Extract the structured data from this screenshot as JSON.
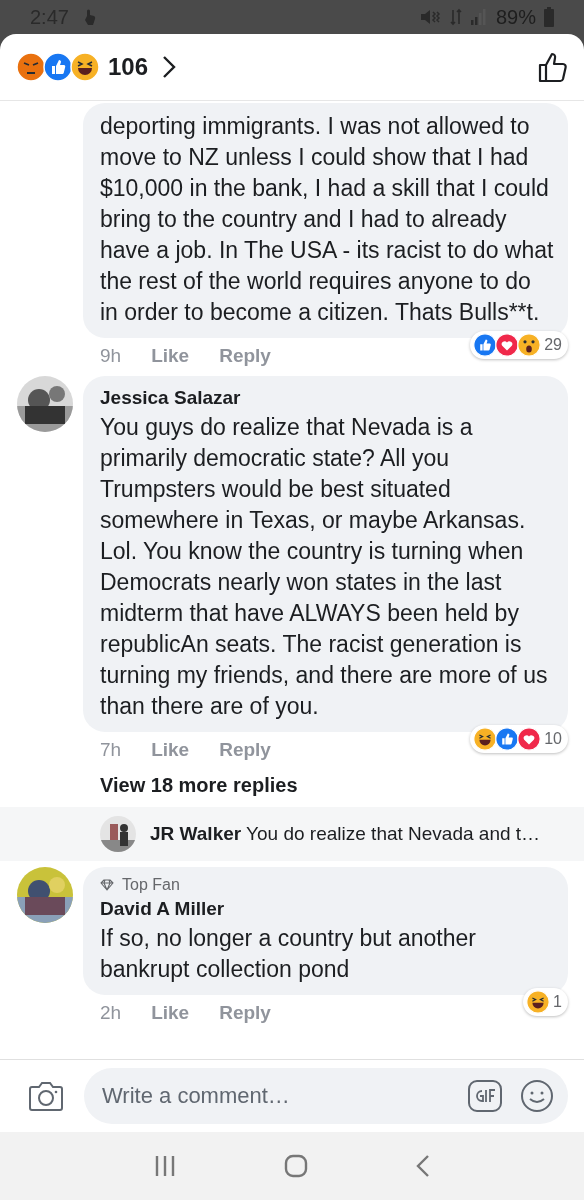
{
  "status_bar": {
    "time": "2:47",
    "battery": "89%"
  },
  "header": {
    "reactions": [
      {
        "kind": "angry"
      },
      {
        "kind": "like"
      },
      {
        "kind": "haha"
      }
    ],
    "count": "106"
  },
  "comments": [
    {
      "text": "deporting immigrants. I was not allowed to move to NZ unless I could show that I had $10,000 in the bank, I had a skill that I could bring to the country and I had to already have a job.   In The USA - its racist to do what the rest of the world requires anyone to do in order to become a citizen. Thats Bulls**t.",
      "time": "9h",
      "like": "Like",
      "reply": "Reply",
      "reactions": [
        {
          "kind": "like"
        },
        {
          "kind": "love"
        },
        {
          "kind": "wow"
        }
      ],
      "reaction_count": "29"
    },
    {
      "author": "Jessica Salazar",
      "text": "You guys do realize that Nevada is a primarily democratic state? All you Trumpsters would be best situated somewhere in Texas, or maybe Arkansas. Lol. You know the country is turning when Democrats nearly won states in the last midterm that have ALWAYS been held by republicAn seats. The racist generation is turning my friends, and there are more of us than there are of you.",
      "time": "7h",
      "like": "Like",
      "reply": "Reply",
      "reactions": [
        {
          "kind": "haha"
        },
        {
          "kind": "like"
        },
        {
          "kind": "love"
        }
      ],
      "reaction_count": "10",
      "more_replies": "View 18 more replies",
      "reply_preview": {
        "author": "JR Walker",
        "text": "You do realize that Nevada and t…"
      }
    },
    {
      "badge": "Top Fan",
      "author": "David A Miller",
      "text": "If so, no longer a country but another bankrupt collection pond",
      "time": "2h",
      "like": "Like",
      "reply": "Reply",
      "reactions": [
        {
          "kind": "haha"
        }
      ],
      "reaction_count": "1"
    }
  ],
  "composer": {
    "placeholder": "Write a comment…"
  }
}
